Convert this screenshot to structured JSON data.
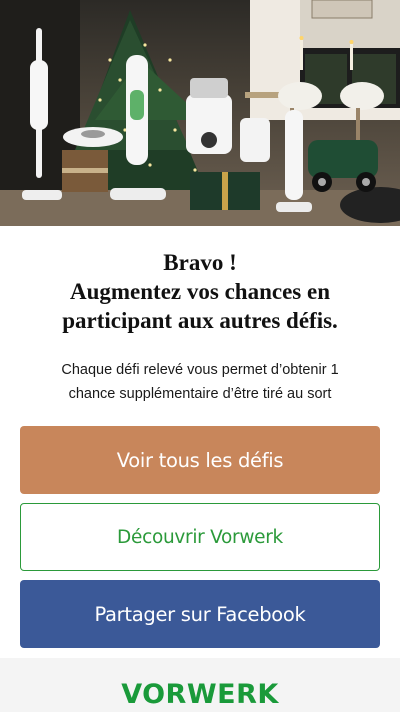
{
  "hero": {
    "alt": "Vorwerk appliances displayed around a Christmas tree",
    "accent": "#2b9a3a"
  },
  "headline": {
    "line1": "Bravo !",
    "line2": "Augmentez vos chances en",
    "line3": "participant aux autres défis."
  },
  "subtitle": {
    "line1": "Chaque défi relevé vous permet d’obtenir 1",
    "line2": "chance supplémentaire d’être tiré au sort"
  },
  "buttons": {
    "challenges": {
      "label": "Voir tous les défis",
      "color": "#c8865b"
    },
    "discover": {
      "label": "Découvrir Vorwerk",
      "color": "#2b9a3a"
    },
    "facebook": {
      "label": "Partager sur Facebook",
      "color": "#3b5998"
    }
  },
  "footer": {
    "logo": "VORWERK",
    "logo_color": "#1a9a3a"
  }
}
